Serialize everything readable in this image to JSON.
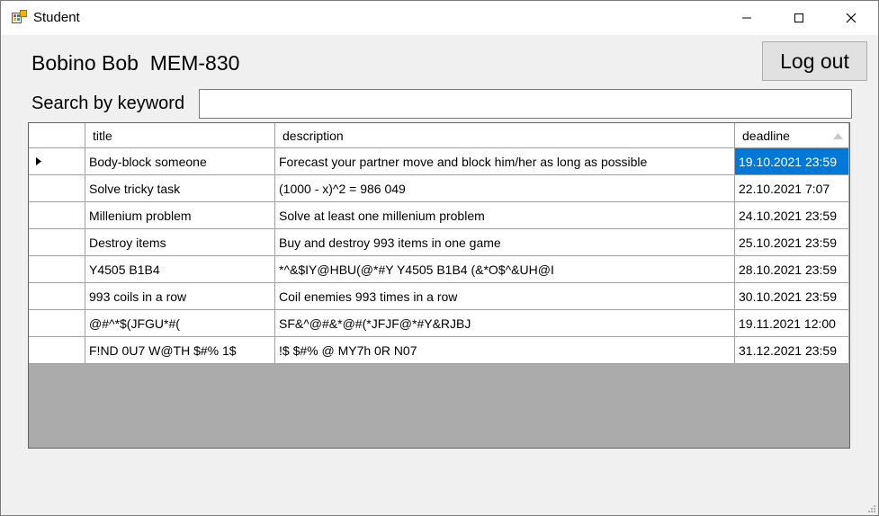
{
  "window": {
    "title": "Student",
    "icons": [
      "app-icon",
      "minimize-icon",
      "maximize-icon",
      "close-icon"
    ]
  },
  "user": {
    "display": "Bobino Bob  MEM-830"
  },
  "logout_label": "Log out",
  "search": {
    "label": "Search by keyword",
    "value": ""
  },
  "grid": {
    "columns": [
      "title",
      "description",
      "deadline"
    ],
    "sort_column": "deadline",
    "sort_direction": "ascending",
    "selected_row": 0,
    "rows": [
      {
        "title": "Body-block someone",
        "description": "Forecast your partner move and block him/her as long as possible",
        "deadline": "19.10.2021 23:59"
      },
      {
        "title": "Solve tricky task",
        "description": "(1000 - x)^2 = 986 049",
        "deadline": "22.10.2021 7:07"
      },
      {
        "title": "Millenium problem",
        "description": "Solve at least one millenium problem",
        "deadline": "24.10.2021 23:59"
      },
      {
        "title": "Destroy items",
        "description": "Buy and destroy 993 items in one game",
        "deadline": "25.10.2021 23:59"
      },
      {
        "title": "Y4505 B1B4",
        "description": "*^&$IY@HBU(@*#Y Y4505 B1B4 (&*O$^&UH@I",
        "deadline": "28.10.2021 23:59"
      },
      {
        "title": "993 coils in a row",
        "description": "Coil enemies 993 times in a row",
        "deadline": "30.10.2021 23:59"
      },
      {
        "title": "@#^*$(JFGU*#(",
        "description": "SF&^@#&*@#(*JFJF@*#Y&RJBJ",
        "deadline": "19.11.2021 12:00"
      },
      {
        "title": "F!ND 0U7 W@TH $#% 1$",
        "description": "!$ $#% @ MY7h 0R N07",
        "deadline": "31.12.2021 23:59"
      }
    ]
  },
  "colors": {
    "selection": "#0078d7",
    "grid_background": "#ababab",
    "window_background": "#f0f0f0"
  }
}
